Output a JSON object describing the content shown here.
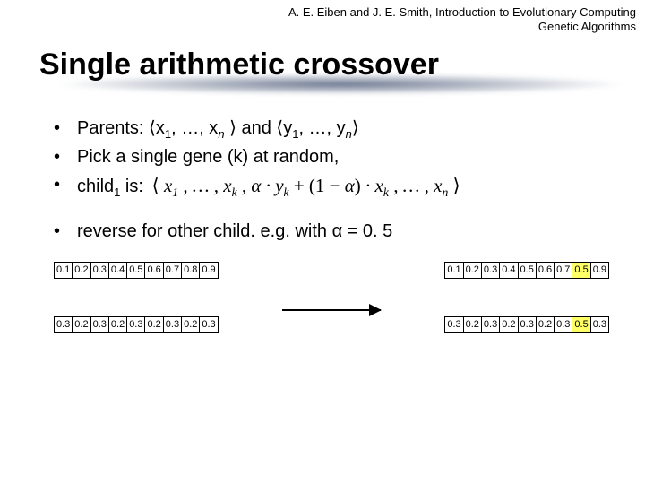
{
  "header": {
    "line1": "A. E. Eiben and J. E. Smith, Introduction to Evolutionary Computing",
    "line2": "Genetic Algorithms"
  },
  "title": "Single arithmetic crossover",
  "bullets": {
    "b1_pre": "Parents: ⟨x",
    "b1_mid1": ", …, x",
    "b1_mid2": " ⟩ and ⟨y",
    "b1_mid3": ", …, y",
    "b1_post": "⟩",
    "b2": "Pick a single gene (k) at random,",
    "b3_pre": "child",
    "b3_post": " is:",
    "b4": "reverse for other child. e.g. with α = 0. 5"
  },
  "formula": {
    "text": "⟨ x₁ , … , xₖ , α · yₖ + (1 − α) · xₖ , … , xₙ ⟩"
  },
  "seqs": {
    "p1": [
      "0.1",
      "0.2",
      "0.3",
      "0.4",
      "0.5",
      "0.6",
      "0.7",
      "0.8",
      "0.9"
    ],
    "p2": [
      "0.3",
      "0.2",
      "0.3",
      "0.2",
      "0.3",
      "0.2",
      "0.3",
      "0.2",
      "0.3"
    ],
    "c1": [
      "0.1",
      "0.2",
      "0.3",
      "0.4",
      "0.5",
      "0.6",
      "0.7",
      "0.5",
      "0.9"
    ],
    "c2": [
      "0.3",
      "0.2",
      "0.3",
      "0.2",
      "0.3",
      "0.2",
      "0.3",
      "0.5",
      "0.3"
    ]
  },
  "hl_index": 7
}
